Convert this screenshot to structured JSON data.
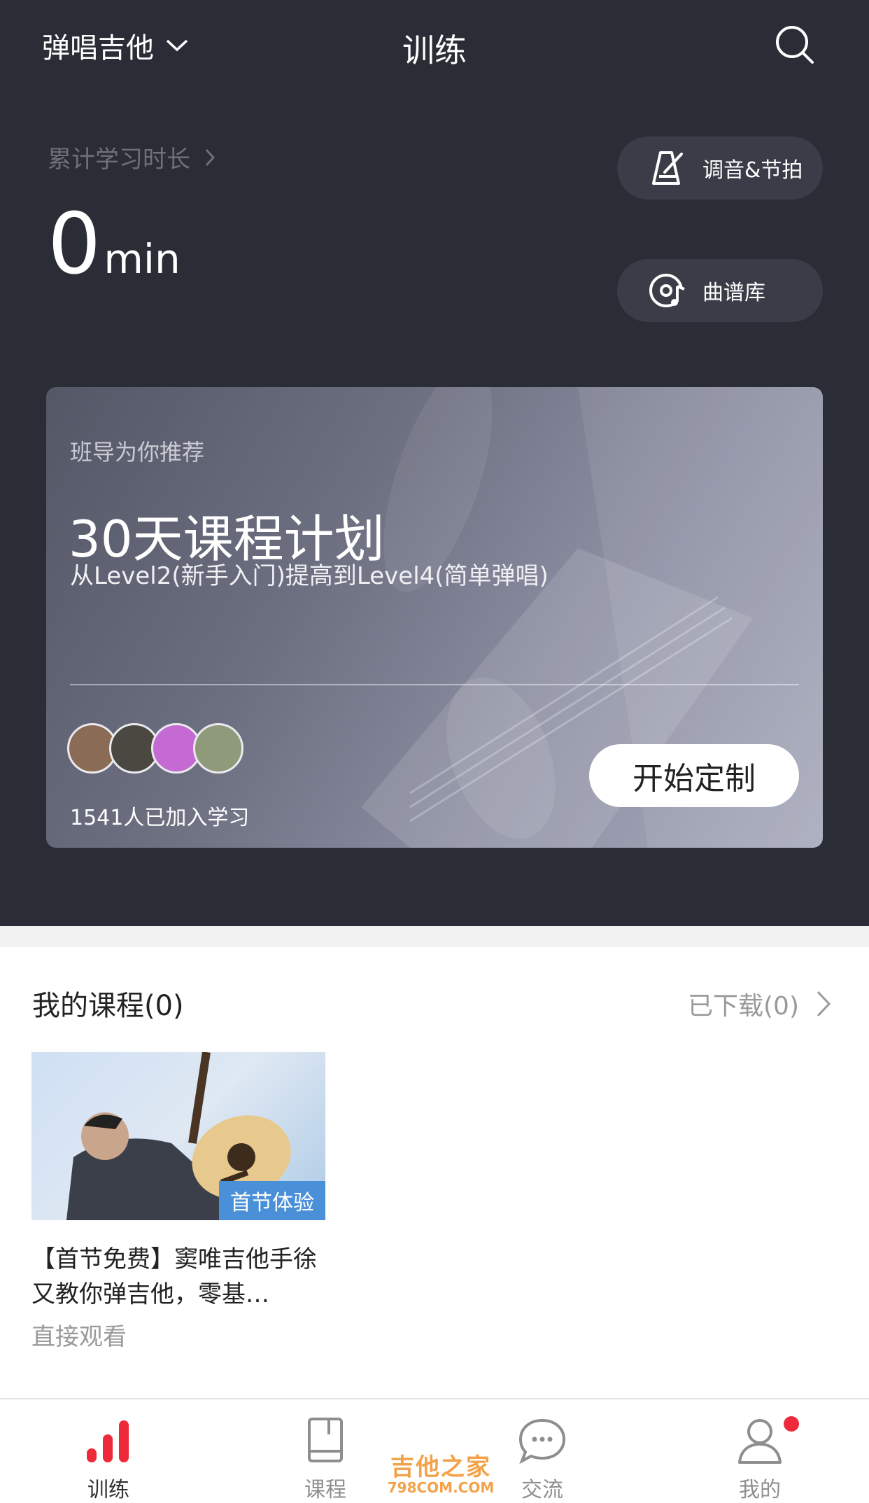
{
  "header": {
    "instrument_selector": "弹唱吉他",
    "title": "训练"
  },
  "study": {
    "label": "累计学习时长",
    "value": "0",
    "unit": "min"
  },
  "tools": {
    "tuner_label": "调音&节拍",
    "library_label": "曲谱库"
  },
  "recommend": {
    "eyebrow": "班导为你推荐",
    "title": "30天课程计划",
    "subtitle": "从Level2(新手入门)提高到Level4(简单弹唱)",
    "joined": "1541人已加入学习",
    "cta": "开始定制",
    "avatar_colors": [
      "#8a6b55",
      "#4b4741",
      "#c46ad2",
      "#8e9a7a"
    ]
  },
  "my_courses": {
    "title": "我的课程(0)",
    "downloaded": "已下载(0)",
    "items": [
      {
        "badge": "首节体验",
        "title": "【首节免费】窦唯吉他手徐又教你弹吉他，零基…",
        "meta": "直接观看"
      }
    ]
  },
  "tabbar": {
    "items": [
      {
        "label": "训练",
        "icon": "bar-chart-icon"
      },
      {
        "label": "课程",
        "icon": "book-icon"
      },
      {
        "label": "交流",
        "icon": "chat-bubble-icon"
      },
      {
        "label": "我的",
        "icon": "user-icon"
      }
    ]
  },
  "watermark": {
    "brand": "吉他之家",
    "site": "798COM.COM"
  },
  "colors": {
    "header_bg": "#2b2d36",
    "accent_red": "#ee2a3a",
    "badge_blue": "#4a90d9"
  }
}
